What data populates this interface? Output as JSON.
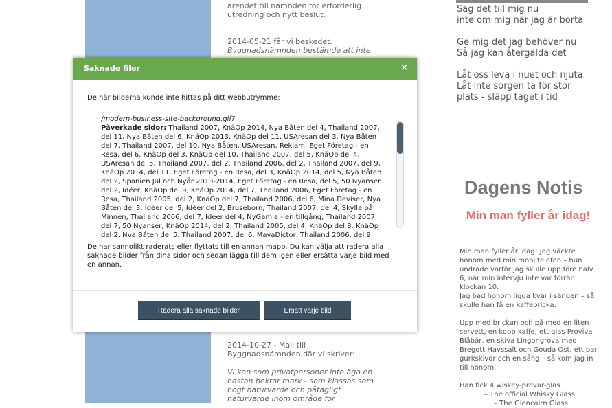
{
  "background": {
    "left_top_lines": [
      "ärendet till nämnden för erforderlig",
      "utredning och nytt beslut."
    ],
    "left_entry1_date": "2014-05-21 får vi beskedet.",
    "left_entry1_quote": "Byggnadsnämnden bestämde att inte",
    "left_entry2_date": "2014-10-27 - Mail till",
    "left_entry2_line": "Byggnadsnämnden där vi skriver:",
    "left_entry2_quote": [
      "Vi kan som privatpersoner inte äga en",
      "nästan hektar mark - som klassas som",
      "högt naturvärde och påtagligt",
      "naturvärde inom område för"
    ],
    "poem_lines": [
      "Säg det till mig nu",
      "inte om mig när jag är borta",
      "Ge mig det jag behöver nu",
      "Så jag kan återgälda det",
      "Låt oss leva i nuet och njuta",
      "Låt inte sorgen ta för stor",
      "plats - släpp taget i tid"
    ],
    "notis_title": "Dagens Notis",
    "notis_headline": "Min man fyller år idag!",
    "notis_paragraphs": [
      "Min man fyller år idag! Jag väckte",
      "honom med min mobiltelefon – hun",
      "undrade varför jag skulle upp före halv",
      "6, när min intervju inte var förrän",
      "klockan 10.",
      "Jag bad honom ligga kvar i sängen – så",
      "skulle han få en kaffebricka.",
      "",
      "Upp med brickan och på med en liten",
      "servett, en kopp kaffe, ett glas Proviva",
      "Blåbär, en skiva Lingongrova med",
      "Bregott Havssalt och Gouda Ost, ett par",
      "gurkskivor och en sång – så kom jag in",
      "till honom.",
      "",
      "Han fick 4 wiskey-provar-glas",
      "– The official Whisky Glass",
      "– The Glencairn Glass"
    ]
  },
  "dialog": {
    "title": "Saknade filer",
    "close_symbol": "×",
    "intro": "De här bilderna kunde inte hittas på ditt webbutrymme:",
    "file_name": "/modern-business-site-background.gif?",
    "affected_label": "Påverkade sidor:",
    "affected_pages": "Thailand 2007, KnäOp 2014, Nya Båten del 4, Thailand 2007, del 11, Nya Båten del 6, KnäOp 2013, KnäOp del 11, USAresan del 3, Nya Båten del 7, Thailand 2007, del 10, Nya Båten, USAresan, Reklam, Eget Företag - en Resa, del 6, KnäOp del 3, KnäOp del 10, Thailand 2007, del 5, KnäOp del 4, USAresan del 5, Thailand 2007, del 2, Thailand 2006, del 2, Thailand 2007, del 9, KnäOp 2014, del 11, Eget Företag - en Resa, del 3, KnäOp 2014, del 5, Nya Båten del 2, Spanien Jul och Nyår 2013-2014, Eget Företag - en Resa, del 5, 50 Nyanser del 2, Idéer, KnäOp del 9, KnäOp 2014, del 7, Thailand 2006, Eget Företag - en Resa, Thailand 2005, del 2, KnäOp del 7, Thailand 2006, del 6, Mina Deviser, Nya Båten del 3, Idéer del 5, Idéer del 2, Bruseborn, Thailand 2007, del 4, Skylla på Minnen, Thailand 2006, del 7, Idéer del 4, NyGamla - en tillgång, Thailand 2007, del 7, 50 Nyanser, KnäOp 2014, del 2, Thailand 2005, del 4, KnäOp del 8, KnäOp del 2, Nya Båten del 5, Thailand 2007, del 6, MayaDictor, Thailand 2006, del 9, Thailand 2007, del 8",
    "note": "De har sannolikt raderats eller flyttats till en annan mapp. Du kan välja att radera alla saknade bilder från dina sidor och sedan lägga till dem igen eller ersätta varje bild med en annan.",
    "delete_all_label": "Radera alla saknade bilder",
    "replace_label": "Ersätt varje bild"
  },
  "colors": {
    "header": "#6aa84f",
    "button": "#3c5162",
    "sidebar": "#8fb3d7",
    "notis_headline": "#e66a6a"
  }
}
